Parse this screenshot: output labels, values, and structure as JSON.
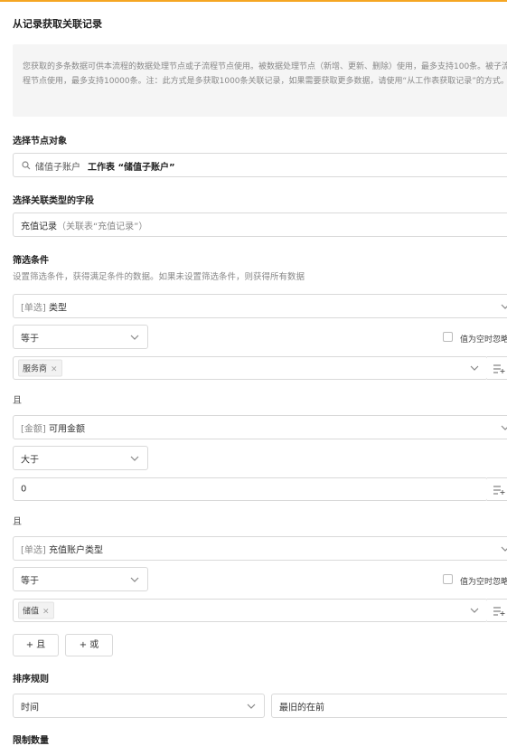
{
  "title": "从记录获取关联记录",
  "tip": "您获取的多条数据可供本流程的数据处理节点或子流程节点使用。被数据处理节点（新增、更新、删除）使用，最多支持100条。被子流程节点使用，最多支持10000条。注：此方式是多获取1000条关联记录，如果需要获取更多数据，请使用“从工作表获取记录”的方式。",
  "node": {
    "label": "选择节点对象",
    "value_prefix": "储值子账户",
    "value_main": "工作表 “储值子账户”"
  },
  "field": {
    "label": "选择关联类型的字段",
    "value": "充值记录",
    "hint": "（关联表“充值记录”）"
  },
  "filter": {
    "label": "筛选条件",
    "desc": "设置筛选条件，获得满足条件的数据。如果未设置筛选条件，则获得所有数据",
    "conditions": [
      {
        "type_tag": "[单选]",
        "field": "类型",
        "op": "等于",
        "ignore_label": "值为空时忽略",
        "value_tag": "服务商"
      },
      {
        "type_tag": "[金额]",
        "field": "可用金额",
        "op": "大于",
        "value": "0"
      },
      {
        "type_tag": "[单选]",
        "field": "充值账户类型",
        "op": "等于",
        "ignore_label": "值为空时忽略",
        "value_tag": "储值"
      }
    ],
    "and_label": "且",
    "add_and": "+ 且",
    "add_or": "+ 或"
  },
  "sort": {
    "label": "排序规则",
    "field": "时间",
    "order": "最旧的在前"
  },
  "limit": {
    "label": "限制数量"
  },
  "colors": {
    "accent": "#f5a623",
    "border": "#d9d9d9",
    "tip_bg": "#f5f5f5"
  }
}
